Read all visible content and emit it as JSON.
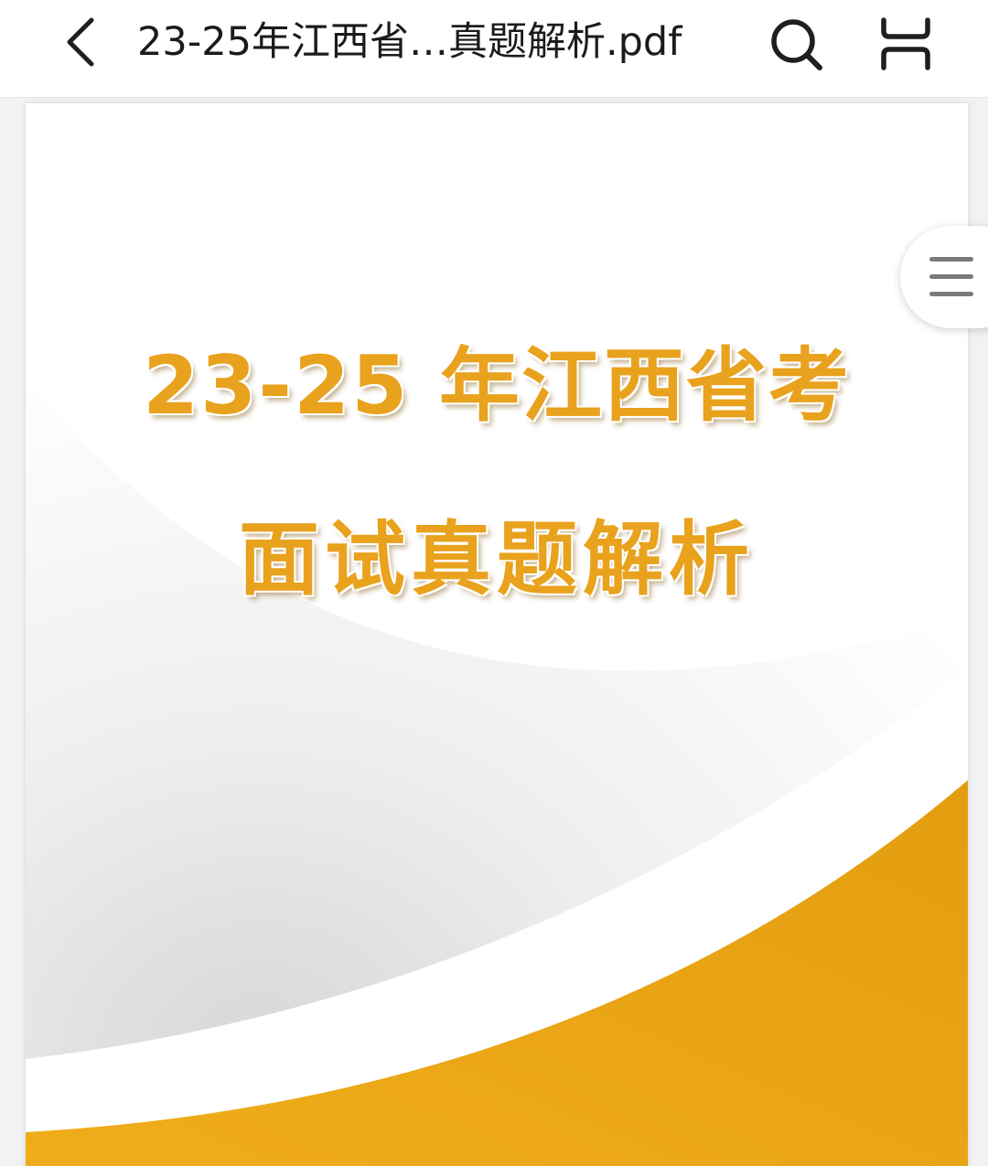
{
  "header": {
    "title": "23-25年江西省…真题解析.pdf",
    "back_icon": "chevron-left-icon",
    "search_icon": "search-icon",
    "reader_icon": "reader-mode-icon"
  },
  "document": {
    "cover_line1": "23-25 年江西省考",
    "cover_line2": "面试真题解析",
    "accent_color": "#e9a21d",
    "wave_color": "#eea51a"
  },
  "menu": {
    "icon": "hamburger-menu-icon"
  }
}
